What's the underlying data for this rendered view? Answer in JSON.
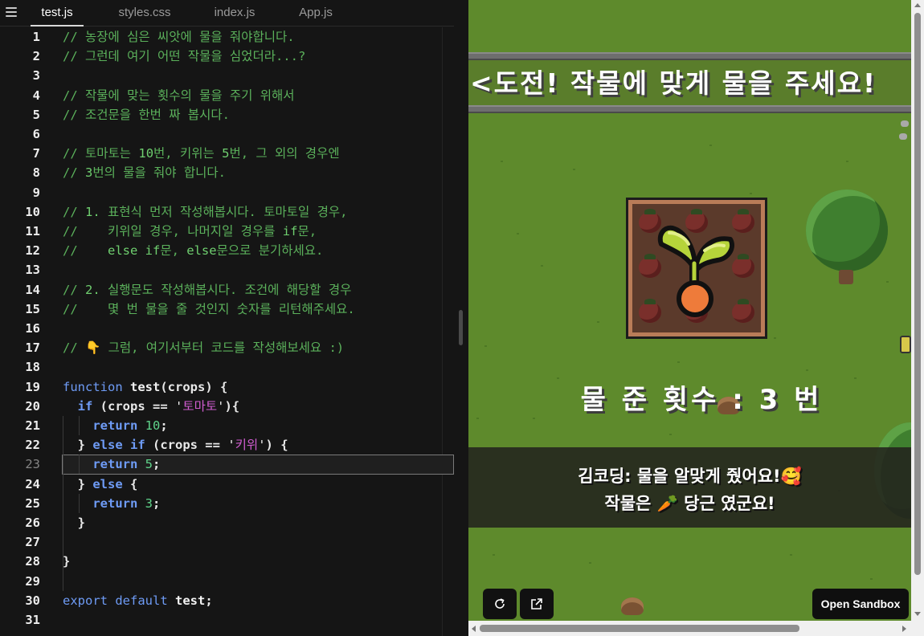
{
  "editor": {
    "tabs": [
      {
        "label": "test.js",
        "active": true
      },
      {
        "label": "styles.css",
        "active": false
      },
      {
        "label": "index.js",
        "active": false
      },
      {
        "label": "App.js",
        "active": false
      }
    ],
    "active_line": 23,
    "lines": [
      {
        "n": "1",
        "text": [
          [
            "c-cm",
            "// 농장에 심은 씨앗에 물을 줘야합니다."
          ]
        ]
      },
      {
        "n": "2",
        "text": [
          [
            "c-cm",
            "// 그런데 여기 어떤 작물을 심었더라...?"
          ]
        ]
      },
      {
        "n": "3",
        "text": []
      },
      {
        "n": "4",
        "text": [
          [
            "c-cm",
            "// 작물에 맞는 횟수의 물을 주기 위해서"
          ]
        ]
      },
      {
        "n": "5",
        "text": [
          [
            "c-cm",
            "// 조건문을 한번 짜 봅시다."
          ]
        ]
      },
      {
        "n": "6",
        "text": []
      },
      {
        "n": "7",
        "text": [
          [
            "c-cm",
            "// 토마토는 "
          ],
          [
            "c-cmn",
            "10"
          ],
          [
            "c-cm",
            "번, 키위는 "
          ],
          [
            "c-cmn",
            "5"
          ],
          [
            "c-cm",
            "번, 그 외의 경우엔"
          ]
        ]
      },
      {
        "n": "8",
        "text": [
          [
            "c-cm",
            "// "
          ],
          [
            "c-cmn",
            "3"
          ],
          [
            "c-cm",
            "번의 물을 줘야 합니다."
          ]
        ]
      },
      {
        "n": "9",
        "text": []
      },
      {
        "n": "10",
        "text": [
          [
            "c-cm",
            "// "
          ],
          [
            "c-cmn",
            "1."
          ],
          [
            "c-cm",
            " 표현식 먼저 작성해봅시다. 토마토일 경우,"
          ]
        ]
      },
      {
        "n": "11",
        "text": [
          [
            "c-cm",
            "//    키위일 경우, 나머지일 경우를 "
          ],
          [
            "c-cmn",
            "if"
          ],
          [
            "c-cm",
            "문,"
          ]
        ]
      },
      {
        "n": "12",
        "text": [
          [
            "c-cm",
            "//    "
          ],
          [
            "c-cmn",
            "else if"
          ],
          [
            "c-cm",
            "문, "
          ],
          [
            "c-cmn",
            "else"
          ],
          [
            "c-cm",
            "문으로 분기하세요."
          ]
        ]
      },
      {
        "n": "13",
        "text": []
      },
      {
        "n": "14",
        "text": [
          [
            "c-cm",
            "// "
          ],
          [
            "c-cmn",
            "2."
          ],
          [
            "c-cm",
            " 실행문도 작성해봅시다. 조건에 해당할 경우"
          ]
        ]
      },
      {
        "n": "15",
        "text": [
          [
            "c-cm",
            "//    몇 번 물을 줄 것인지 숫자를 리턴해주세요."
          ]
        ]
      },
      {
        "n": "16",
        "text": []
      },
      {
        "n": "17",
        "text": [
          [
            "c-cm",
            "// 👇 그럼, 여기서부터 코드를 작성해보세요 :)"
          ]
        ]
      },
      {
        "n": "18",
        "text": []
      },
      {
        "n": "19",
        "text": [
          [
            "c-kw2",
            "function "
          ],
          [
            "c-fn",
            "test"
          ],
          [
            "c-pl",
            "(crops) {"
          ]
        ]
      },
      {
        "n": "20",
        "text": [
          [
            "c-pl",
            "  "
          ],
          [
            "c-kw",
            "if"
          ],
          [
            "c-pl",
            " (crops == "
          ],
          [
            "c-q",
            "'"
          ],
          [
            "c-st",
            "토마토"
          ],
          [
            "c-q",
            "'"
          ],
          [
            "c-pl",
            "){"
          ]
        ]
      },
      {
        "n": "21",
        "text": [
          [
            "c-pl",
            "    "
          ],
          [
            "c-kw",
            "return"
          ],
          [
            "c-pl",
            " "
          ],
          [
            "c-num",
            "10"
          ],
          [
            "c-pl",
            ";"
          ]
        ]
      },
      {
        "n": "22",
        "text": [
          [
            "c-pl",
            "  } "
          ],
          [
            "c-kw",
            "else if"
          ],
          [
            "c-pl",
            " (crops == "
          ],
          [
            "c-q",
            "'"
          ],
          [
            "c-st",
            "키위"
          ],
          [
            "c-q",
            "'"
          ],
          [
            "c-pl",
            ") {"
          ]
        ]
      },
      {
        "n": "23",
        "text": [
          [
            "c-pl",
            "    "
          ],
          [
            "c-kw",
            "return"
          ],
          [
            "c-pl",
            " "
          ],
          [
            "c-num",
            "5"
          ],
          [
            "c-pl",
            ";"
          ]
        ]
      },
      {
        "n": "24",
        "text": [
          [
            "c-pl",
            "  } "
          ],
          [
            "c-kw",
            "else"
          ],
          [
            "c-pl",
            " {"
          ]
        ]
      },
      {
        "n": "25",
        "text": [
          [
            "c-pl",
            "    "
          ],
          [
            "c-kw",
            "return"
          ],
          [
            "c-pl",
            " "
          ],
          [
            "c-num",
            "3"
          ],
          [
            "c-pl",
            ";"
          ]
        ]
      },
      {
        "n": "26",
        "text": [
          [
            "c-pl",
            "  }"
          ]
        ]
      },
      {
        "n": "27",
        "text": []
      },
      {
        "n": "28",
        "text": [
          [
            "c-pl",
            "}"
          ]
        ]
      },
      {
        "n": "29",
        "text": []
      },
      {
        "n": "30",
        "text": [
          [
            "c-kw2",
            "export default "
          ],
          [
            "c-fn",
            "test"
          ],
          [
            "c-pl",
            ";"
          ]
        ]
      },
      {
        "n": "31",
        "text": []
      }
    ]
  },
  "preview": {
    "banner_title": "<도전! 작물에 맞게 물을 주세요!",
    "score_text": "물 준 횟수 : 3 번",
    "dialog_line1": "김코딩: 물을 알맞게 줬어요!🥰",
    "dialog_line2": "작물은 🥕 당근 였군요!",
    "open_sandbox_label": "Open Sandbox",
    "refresh_icon": "refresh-icon",
    "open_window_icon": "open-in-new-window-icon"
  },
  "colors": {
    "editor_bg": "#151515",
    "comment": "#5bb15b",
    "keyword": "#6e9bf5",
    "string": "#d05cd0",
    "number": "#5fd38a",
    "grass": "#5e8a2c"
  }
}
